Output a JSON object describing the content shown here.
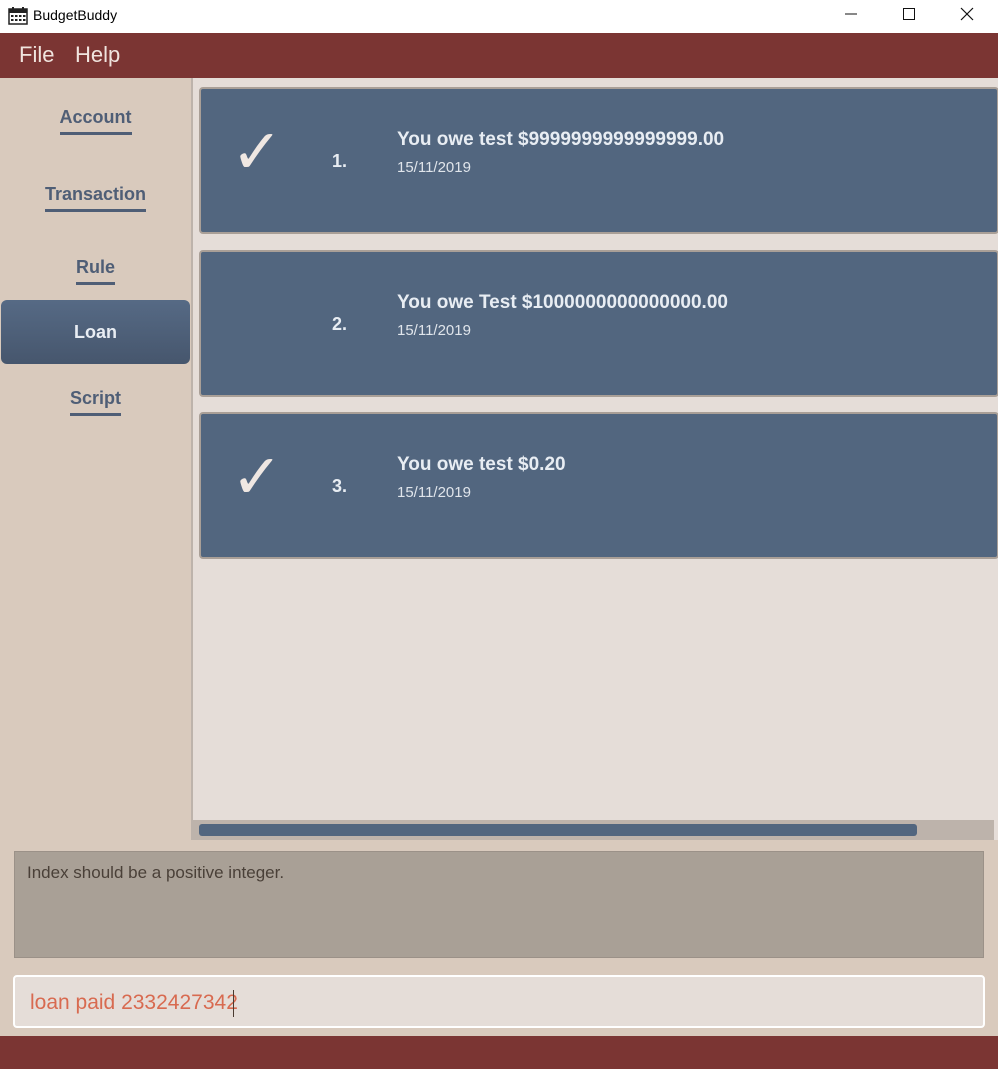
{
  "window": {
    "title": "BudgetBuddy",
    "icon": "calendar-icon",
    "controls": [
      "minimize-icon",
      "maximize-icon",
      "close-icon"
    ]
  },
  "menu": {
    "file": "File",
    "help": "Help"
  },
  "sidebar": {
    "items": [
      {
        "label": "Account"
      },
      {
        "label": "Transaction"
      },
      {
        "label": "Rule"
      },
      {
        "label": "Loan",
        "active": true
      },
      {
        "label": "Script"
      }
    ]
  },
  "loans": [
    {
      "index": "1.",
      "description": "You owe test $9999999999999999.00",
      "date": "15/11/2019",
      "paid": true,
      "mark": "✓"
    },
    {
      "index": "2.",
      "description": "You owe Test $1000000000000000.00",
      "date": "15/11/2019",
      "paid": false,
      "mark": ""
    },
    {
      "index": "3.",
      "description": "You owe test $0.20",
      "date": "15/11/2019",
      "paid": true,
      "mark": "✓"
    }
  ],
  "result": {
    "message": "Index should be a positive integer."
  },
  "command": {
    "value": "loan paid 2332427342"
  },
  "colors": {
    "menubar": "#7b3533",
    "card": "#52667f",
    "sidebar": "#d9cabd",
    "list_bg": "#e5ddd8",
    "command_text": "#d86a50"
  }
}
